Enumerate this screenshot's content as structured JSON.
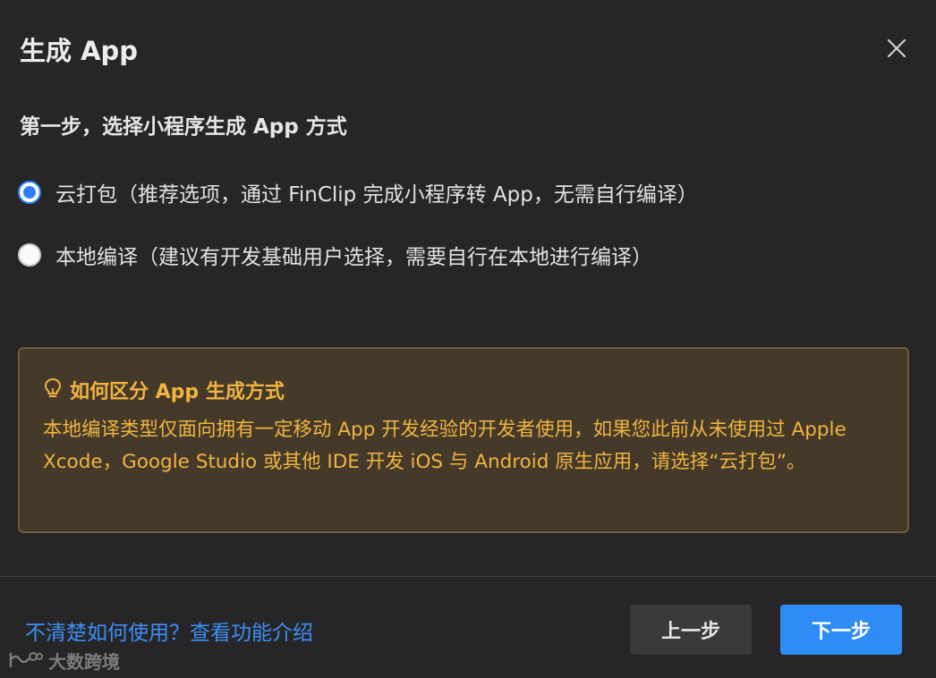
{
  "dialog": {
    "title": "生成 App",
    "close_icon": "close-icon"
  },
  "step": {
    "title": "第一步，选择小程序生成 App 方式"
  },
  "options": [
    {
      "label": "云打包（推荐选项，通过 FinClip 完成小程序转 App，无需自行编译）",
      "checked": true
    },
    {
      "label": "本地编译（建议有开发基础用户选择，需要自行在本地进行编译）",
      "checked": false
    }
  ],
  "notice": {
    "icon": "lightbulb-icon",
    "title": "如何区分 App 生成方式",
    "body": "本地编译类型仅面向拥有一定移动 App 开发经验的开发者使用，如果您此前从未使用过 Apple Xcode，Google Studio 或其他 IDE 开发 iOS 与 Android 原生应用，请选择“云打包”。"
  },
  "footer": {
    "help_link": "不清楚如何使用？查看功能介绍",
    "prev_label": "上一步",
    "next_label": "下一步"
  },
  "watermark": {
    "text": "大数跨境"
  },
  "colors": {
    "background": "#262628",
    "accent": "#2f8cf5",
    "notice_text": "#f0b440",
    "notice_bg": "#45392a",
    "link": "#3d8ef5"
  }
}
